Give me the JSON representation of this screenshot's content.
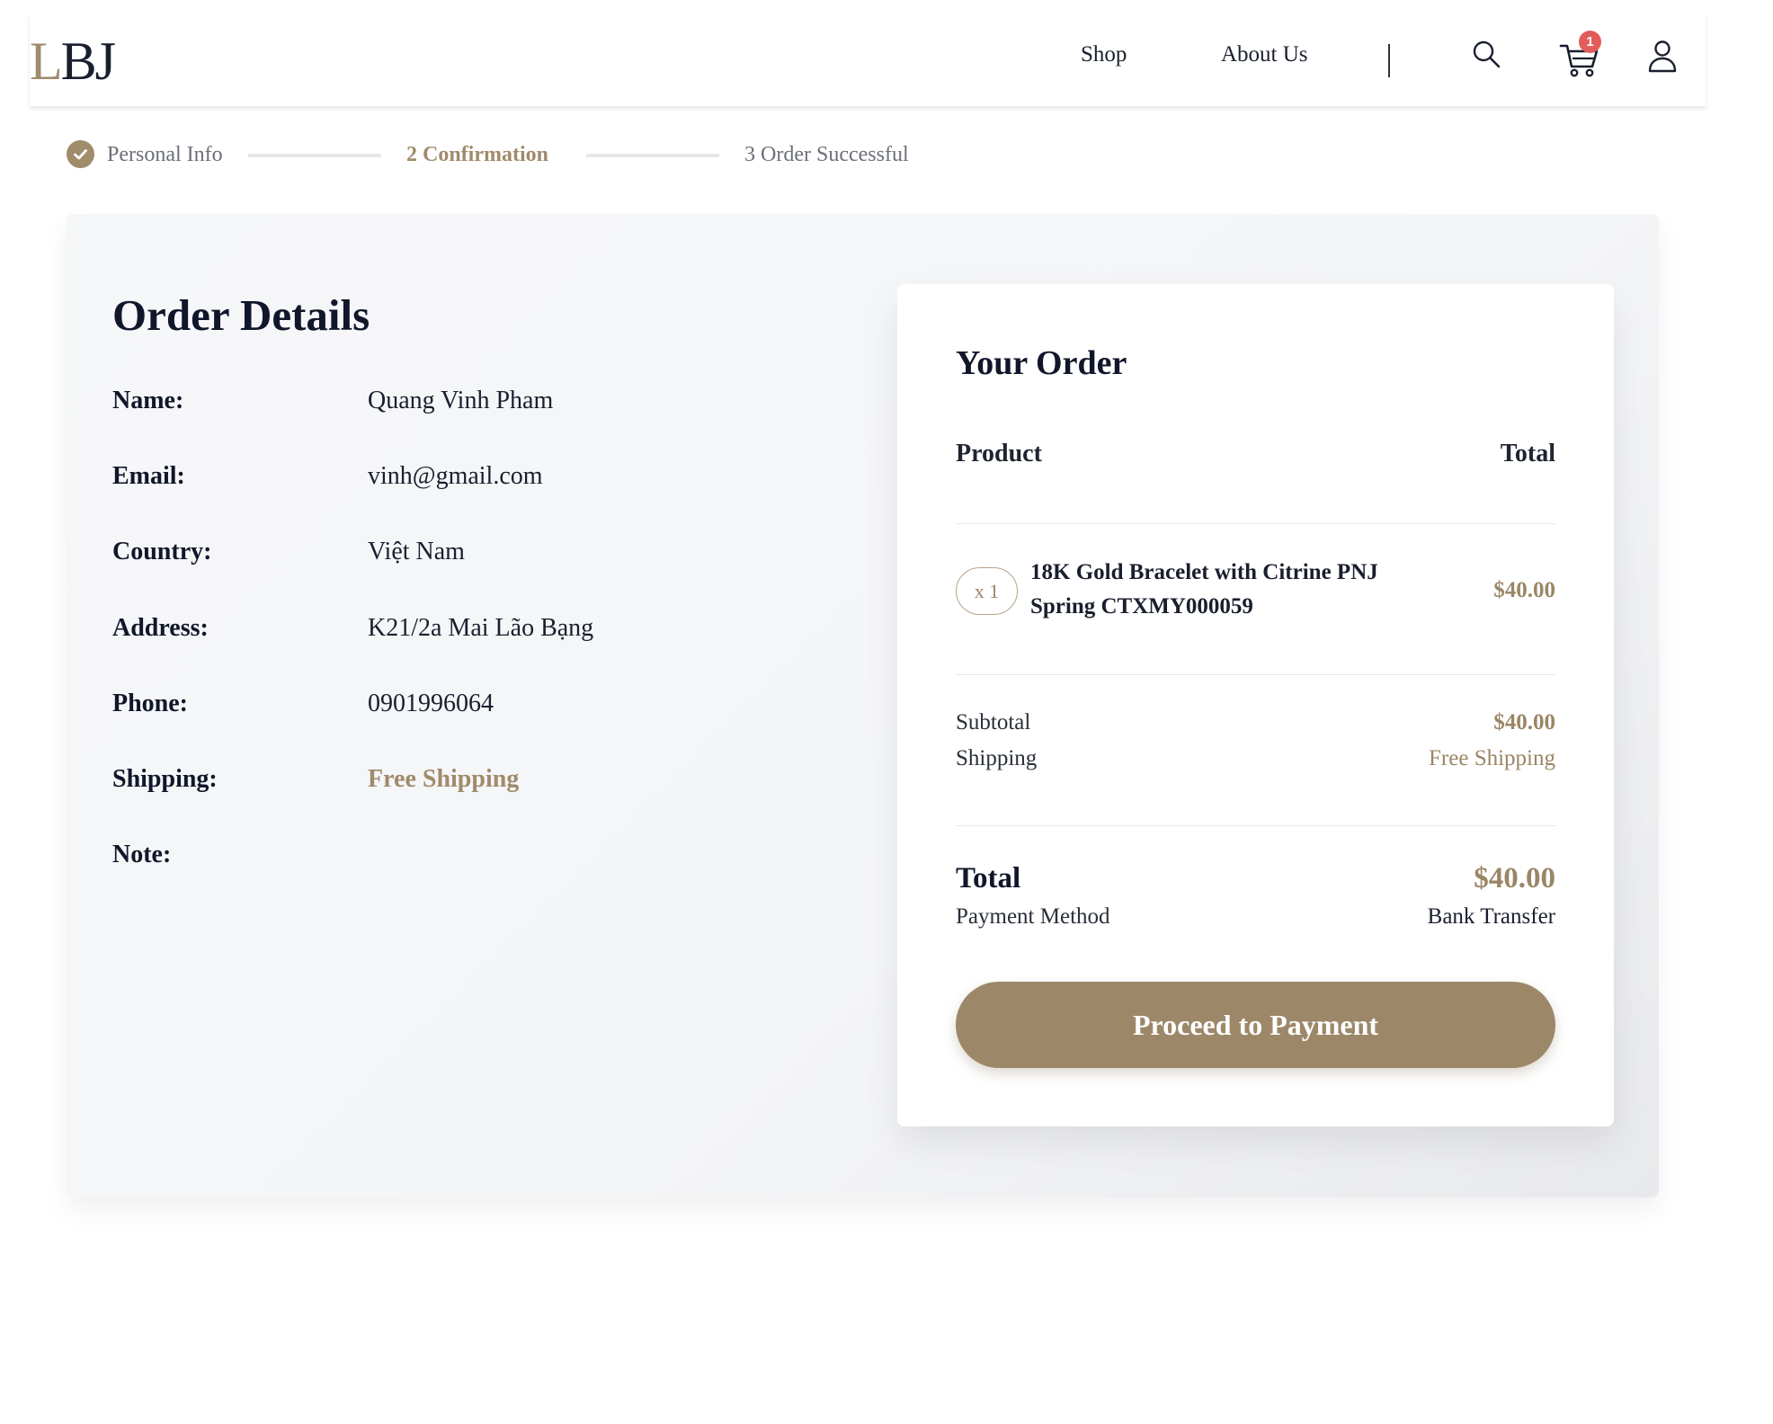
{
  "header": {
    "logo_first": "L",
    "logo_rest": "BJ",
    "nav": {
      "shop": "Shop",
      "about": "About Us"
    },
    "cart_count": "1",
    "icons": [
      "search-icon",
      "cart-icon",
      "user-icon"
    ]
  },
  "stepper": {
    "step1": {
      "label": "Personal Info",
      "state": "done"
    },
    "step2": {
      "label": "2  Confirmation",
      "state": "current"
    },
    "step3": {
      "label": "3  Order Successful",
      "state": "upcoming"
    }
  },
  "order_details": {
    "title": "Order Details",
    "rows": [
      {
        "label": "Name:",
        "value": "Quang Vinh Pham"
      },
      {
        "label": "Email:",
        "value": "vinh@gmail.com"
      },
      {
        "label": "Country:",
        "value": "Việt Nam"
      },
      {
        "label": "Address:",
        "value": "K21/2a Mai Lão Bạng"
      },
      {
        "label": "Phone:",
        "value": "0901996064"
      },
      {
        "label": "Shipping:",
        "value": "Free Shipping"
      },
      {
        "label": "Note:",
        "value": ""
      }
    ]
  },
  "your_order": {
    "title": "Your Order",
    "col_product": "Product",
    "col_total": "Total",
    "item": {
      "qty": "x 1",
      "name": "18K Gold Bracelet with Citrine PNJ Spring CTXMY000059",
      "price": "$40.00"
    },
    "subtotal_label": "Subtotal",
    "subtotal_value": "$40.00",
    "shipping_label": "Shipping",
    "shipping_value": "Free Shipping",
    "total_label": "Total",
    "total_value": "$40.00",
    "payment_method_label": "Payment Method",
    "payment_method_value": "Bank Transfer",
    "button_label": "Proceed to Payment"
  },
  "colors": {
    "accent": "#a08b6b",
    "badge": "#e25c5c",
    "text_dark": "#11172a"
  }
}
